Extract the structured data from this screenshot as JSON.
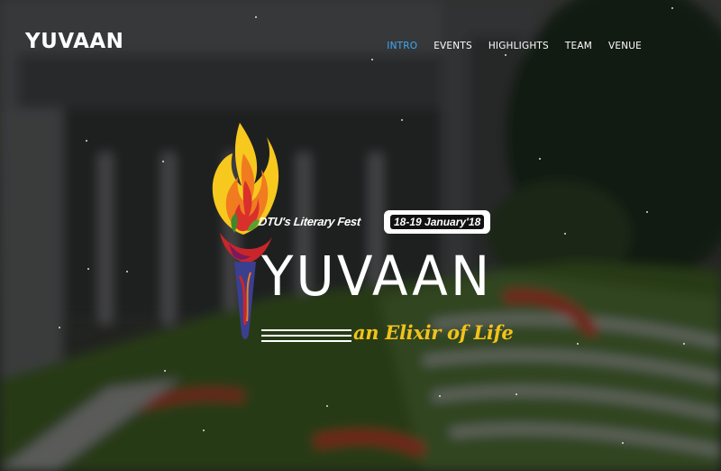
{
  "brand": {
    "name": "YUVAAN"
  },
  "nav": {
    "items": [
      {
        "label": "INTRO",
        "active": true
      },
      {
        "label": "EVENTS",
        "active": false
      },
      {
        "label": "HIGHLIGHTS",
        "active": false
      },
      {
        "label": "TEAM",
        "active": false
      },
      {
        "label": "VENUE",
        "active": false
      }
    ]
  },
  "hero": {
    "tagline": "DTU's Literary Fest",
    "dates": "18-19 January'18",
    "title": "YUVAAN",
    "subtitle": "an Elixir of Life"
  },
  "colors": {
    "accent": "#3fa9f5",
    "subtitle": "#f2c21b",
    "flame_yellow": "#f7c81e",
    "flame_orange": "#f07c1f",
    "flame_red": "#d9302c",
    "torch_handle": "#3b3f8f"
  },
  "icons": {
    "logo": "torch-flame-icon"
  }
}
